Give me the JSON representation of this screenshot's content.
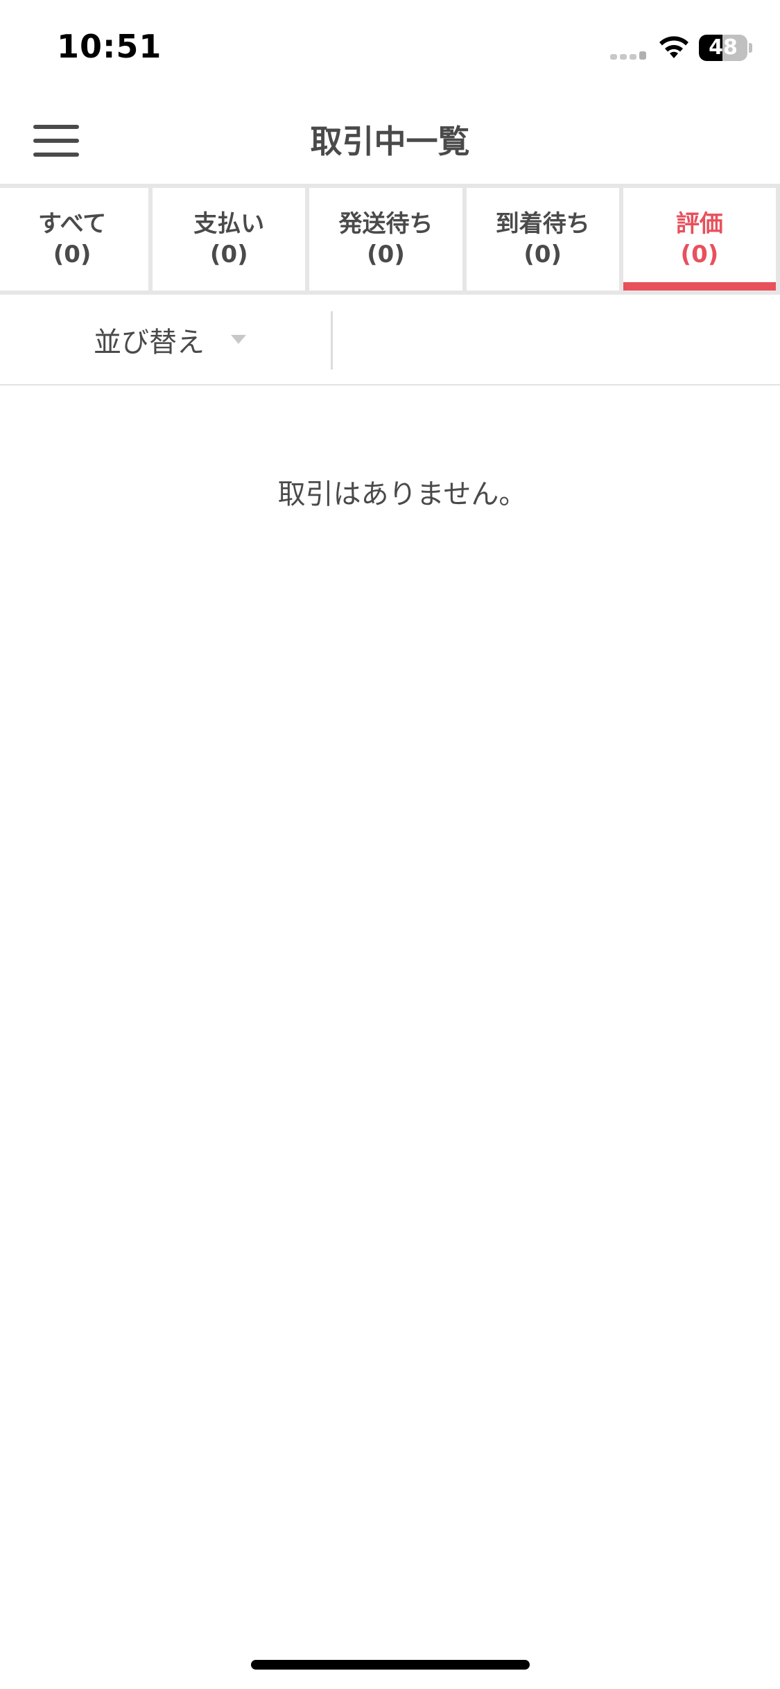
{
  "status_bar": {
    "time": "10:51",
    "battery_level": "48",
    "battery_fraction": 0.48,
    "icons": [
      "cellular-signal-icon",
      "wifi-icon",
      "battery-icon"
    ]
  },
  "header": {
    "title": "取引中一覧",
    "menu_icon": "hamburger-menu-icon"
  },
  "tabs": [
    {
      "label": "すべて",
      "count": "(0)",
      "active": false
    },
    {
      "label": "支払い",
      "count": "(0)",
      "active": false
    },
    {
      "label": "発送待ち",
      "count": "(0)",
      "active": false
    },
    {
      "label": "到着待ち",
      "count": "(0)",
      "active": false
    },
    {
      "label": "評価",
      "count": "(0)",
      "active": true
    }
  ],
  "sort": {
    "label": "並び替え",
    "icon": "caret-down-icon"
  },
  "empty_message": "取引はありません。",
  "colors": {
    "accent": "#e8505b",
    "text": "#4a4a4a",
    "divider": "#e6e6e6"
  }
}
